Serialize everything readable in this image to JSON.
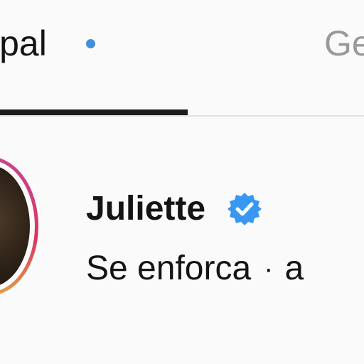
{
  "tabs": [
    {
      "label": "ipal",
      "active": true,
      "has_unread_dot": true
    },
    {
      "label": "Ge",
      "active": false,
      "has_unread_dot": false
    }
  ],
  "colors": {
    "unread_dot": "#3f8fdb",
    "verified_badge": "#3897f0",
    "story_ring_start": "#c9458f",
    "story_ring_end": "#e4a044",
    "inactive_tab": "#9a9a9a"
  },
  "conversation": {
    "avatar_icon": "profile-photo",
    "name": "Juliette",
    "verified": true,
    "verified_icon": "verified-badge-icon",
    "preview": "Se enforca",
    "separator": "·",
    "time": "a"
  }
}
